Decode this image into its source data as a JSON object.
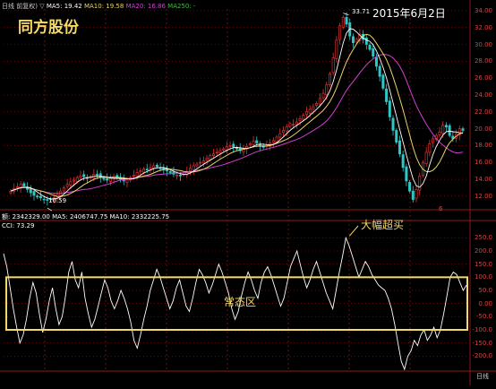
{
  "header": {
    "title": "日线 前复权)",
    "ma5": "MA5: 19.42",
    "ma10": "MA10: 19.58",
    "ma20": "MA20: 16.86",
    "ma250": "MA250: -"
  },
  "stock_title": "同方股份",
  "date_note": "2015年6月2日",
  "peak_label": "33.71",
  "low_label": "10.59",
  "red_mark": "6",
  "volume_header": "额: 2342329.00  MA5: 2406747.75  MA10: 2332225.75",
  "cci_header": "CCI: 73.29",
  "annotation_overbought": "大幅超买",
  "annotation_normal": "常态区",
  "corner_label": "日线",
  "colors": {
    "up": "#e03030",
    "down": "#2fc6c6",
    "ma5": "#ffffff",
    "ma10": "#e8d36a",
    "ma20": "#d040d0",
    "grid": "#8b1a1a",
    "annotation": "#f3d96a"
  },
  "chart_data": [
    {
      "type": "candlestick",
      "title": "同方股份",
      "y_ticks": [
        "34.00",
        "32.00",
        "30.00",
        "28.00",
        "26.00",
        "24.00",
        "22.00",
        "20.00",
        "18.00",
        "16.00",
        "14.00",
        "12.00"
      ],
      "ylim": [
        10.6,
        34.2
      ],
      "peak": 33.71,
      "low": 10.59,
      "series": [
        {
          "name": "MA5",
          "value": 19.42
        },
        {
          "name": "MA10",
          "value": 19.58
        },
        {
          "name": "MA20",
          "value": 16.86
        }
      ],
      "close": [
        12.6,
        12.9,
        13.1,
        13.4,
        13.2,
        12.8,
        12.4,
        12.1,
        11.9,
        11.8,
        11.6,
        11.5,
        11.6,
        11.8,
        12.2,
        12.6,
        13.0,
        13.4,
        13.7,
        13.9,
        14.2,
        14.4,
        14.3,
        14.1,
        14.3,
        14.6,
        14.5,
        14.2,
        14.0,
        13.9,
        14.1,
        14.3,
        14.2,
        14.0,
        13.8,
        13.9,
        14.2,
        14.5,
        14.8,
        15.0,
        15.2,
        15.1,
        15.4,
        15.6,
        15.5,
        15.3,
        15.1,
        15.0,
        14.8,
        14.6,
        14.5,
        14.4,
        14.6,
        14.9,
        15.3,
        15.6,
        15.8,
        16.0,
        16.2,
        16.5,
        16.8,
        17.0,
        17.2,
        17.4,
        17.6,
        17.9,
        18.0,
        17.8,
        17.6,
        17.4,
        17.6,
        17.9,
        18.2,
        18.5,
        18.3,
        18.0,
        17.8,
        18.0,
        18.3,
        18.6,
        19.0,
        19.4,
        19.8,
        20.2,
        20.6,
        20.5,
        20.8,
        21.2,
        21.6,
        22.0,
        22.3,
        22.6,
        23.0,
        23.6,
        24.2,
        25.2,
        26.5,
        28.4,
        30.5,
        32.2,
        33.2,
        32.4,
        31.0,
        30.2,
        30.6,
        31.2,
        30.6,
        30.0,
        29.4,
        28.6,
        27.4,
        26.2,
        24.8,
        23.2,
        21.4,
        19.8,
        18.4,
        17.0,
        15.4,
        13.8,
        12.6,
        11.6,
        12.8,
        14.4,
        16.0,
        17.2,
        18.2,
        18.8,
        19.2,
        19.6,
        20.4,
        20.2,
        19.2,
        18.8,
        19.4,
        20.0,
        19.8
      ]
    },
    {
      "type": "line",
      "title": "CCI",
      "y_ticks": [
        "250.0",
        "200.0",
        "150.0",
        "100.0",
        "50.0",
        "0.00",
        "-50.0",
        "-100.0",
        "-150.0",
        "-200.0"
      ],
      "ylim": [
        -250,
        275
      ],
      "series": [
        {
          "name": "CCI",
          "values": [
            190,
            140,
            60,
            -20,
            -90,
            -150,
            -120,
            -60,
            20,
            80,
            40,
            -40,
            -110,
            -60,
            10,
            60,
            -20,
            -80,
            -50,
            30,
            120,
            160,
            90,
            60,
            120,
            20,
            -40,
            -90,
            -60,
            -10,
            40,
            90,
            60,
            10,
            -20,
            10,
            50,
            20,
            -20,
            -70,
            -140,
            -170,
            -120,
            -60,
            -10,
            50,
            90,
            130,
            100,
            60,
            20,
            -20,
            10,
            60,
            90,
            40,
            -10,
            -30,
            20,
            80,
            130,
            110,
            80,
            40,
            70,
            110,
            150,
            120,
            80,
            40,
            -20,
            -60,
            -30,
            30,
            80,
            120,
            90,
            50,
            20,
            80,
            120,
            140,
            110,
            70,
            30,
            -10,
            20,
            80,
            140,
            170,
            200,
            150,
            100,
            60,
            90,
            130,
            160,
            120,
            80,
            40,
            10,
            -20,
            50,
            120,
            180,
            250,
            220,
            180,
            140,
            100,
            130,
            160,
            140,
            110,
            90,
            70,
            60,
            50,
            20,
            -20,
            -80,
            -150,
            -220,
            -250,
            -200,
            -180,
            -140,
            -160,
            -120,
            -100,
            -140,
            -120,
            -90,
            -130,
            -100,
            -40,
            30,
            100,
            120,
            110,
            80,
            50,
            70
          ]
        }
      ],
      "annotations": [
        "大幅超买",
        "常态区"
      ]
    }
  ]
}
